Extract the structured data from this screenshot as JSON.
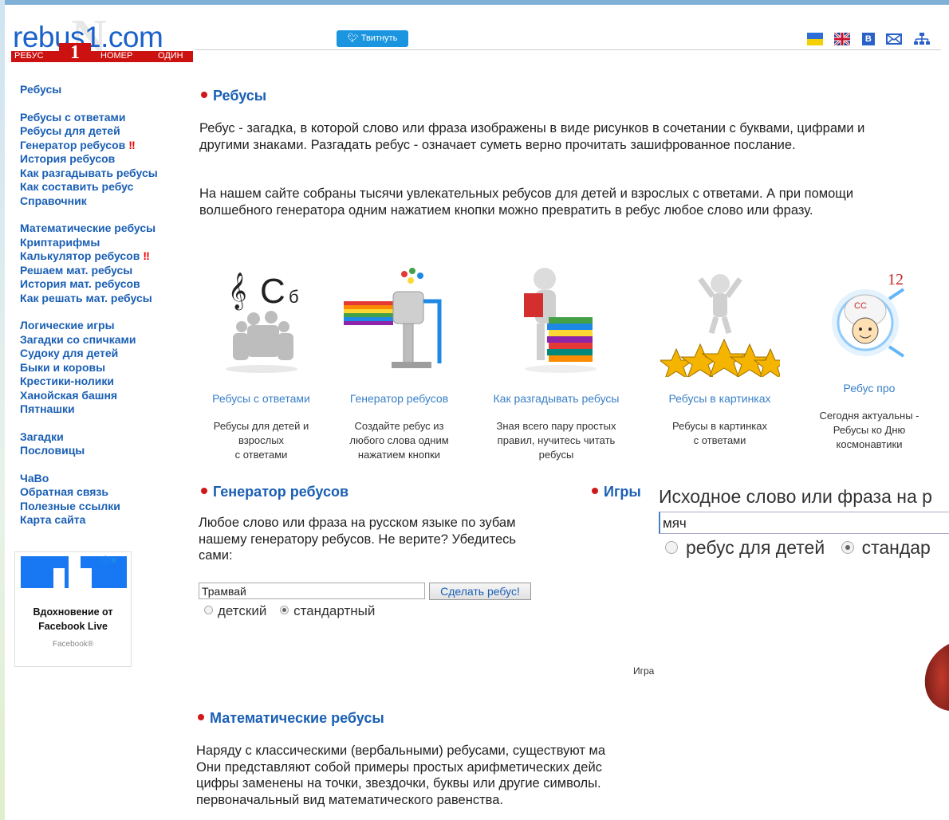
{
  "header": {
    "logo_text": "rebus1.com",
    "logo_bar_left": "РЕБУС",
    "logo_bar_one": "1",
    "logo_bar_mid": "НОМЕР",
    "logo_bar_right": "ОДИН",
    "tweet_label": "Твитнуть",
    "icons": [
      "ukraine-flag-icon",
      "uk-flag-icon",
      "vk-icon",
      "mail-icon",
      "sitemap-icon"
    ]
  },
  "sidebar": {
    "groups": [
      [
        "Ребусы"
      ],
      [
        "Ребусы с ответами",
        "Ребусы для детей",
        "Генератор ребусов",
        "История ребусов",
        "Как разгадывать ребусы",
        "Как составить ребус",
        "Справочник"
      ],
      [
        "Математические ребусы",
        "Криптарифмы",
        "Калькулятор ребусов",
        "Решаем мат. ребусы",
        "История мат. ребусов",
        "Как решать мат. ребусы"
      ],
      [
        "Логические игры",
        "Загадки со спичками",
        "Судоку для детей",
        "Быки и коровы",
        "Крестики-нолики",
        "Ханойская башня",
        "Пятнашки"
      ],
      [
        "Загадки",
        "Пословицы"
      ],
      [
        "ЧаВо",
        "Обратная связь",
        "Полезные ссылки",
        "Карта сайта"
      ]
    ],
    "marker": "‼"
  },
  "ad": {
    "title": "Вдохновение от Facebook Live",
    "source": "Facebook®"
  },
  "rebuses": {
    "heading": "Ребусы",
    "p1": "Ребус - загадка, в которой слово или фраза изображены в виде рисунков в сочетании с буквами, цифрами и другими знаками. Разгадать ребус - означает суметь верно прочитать зашифрованное послание.",
    "p2": "На нашем сайте собраны тысячи увлекательных ребусов для детей и взрослых с ответами. А при помощи волшебного генератора одним нажатием кнопки можно превратить в ребус любое слово или фразу."
  },
  "cards": [
    {
      "title": "Ребусы с ответами",
      "desc": [
        "Ребусы для детей и",
        "взрослых",
        "с ответами"
      ]
    },
    {
      "title": "Генератор ребусов",
      "desc": [
        "Создайте ребус из",
        "любого слова одним",
        "нажатием кнопки"
      ]
    },
    {
      "title": "Как разгадывать ребусы",
      "desc": [
        "Зная всего пару простых",
        "правил, нучитесь читать",
        "ребусы"
      ]
    },
    {
      "title": "Ребусы в картинках",
      "desc": [
        "Ребусы в картинках",
        "с ответами"
      ]
    },
    {
      "title": "Ребус про",
      "desc": [
        "Сегодня актуальны -",
        "Ребусы ко Дню",
        "космонавтики"
      ],
      "badge": "12"
    }
  ],
  "generator": {
    "heading": "Генератор ребусов",
    "text": "Любое слово или фраза на русском языке по зубам нашему генератору ребусов. Не верите? Убедитесь сами:",
    "input_value": "Трамвай",
    "button": "Сделать ребус!",
    "radio_kid": "детский",
    "radio_std": "стандартный"
  },
  "games": {
    "heading": "Игры",
    "caption": "Игра"
  },
  "iframe": {
    "label": "Исходное слово или фраза на р",
    "input_value": "мяч",
    "radio_kid": "ребус для детей",
    "radio_std": "стандар"
  },
  "math": {
    "heading": "Математические ребусы",
    "lines": [
      "Наряду с классическими (вербальными) ребусами, существуют ма",
      "Они представляют собой примеры простых арифметических дейс",
      "цифры заменены на точки, звездочки, буквы или другие символы.",
      "первоначальный вид математического равенства."
    ]
  },
  "colors": {
    "link": "#1a5fb4",
    "logo_red": "#cc1111",
    "bullet_red": "#d01818",
    "tweet_blue": "#1b95e0"
  }
}
